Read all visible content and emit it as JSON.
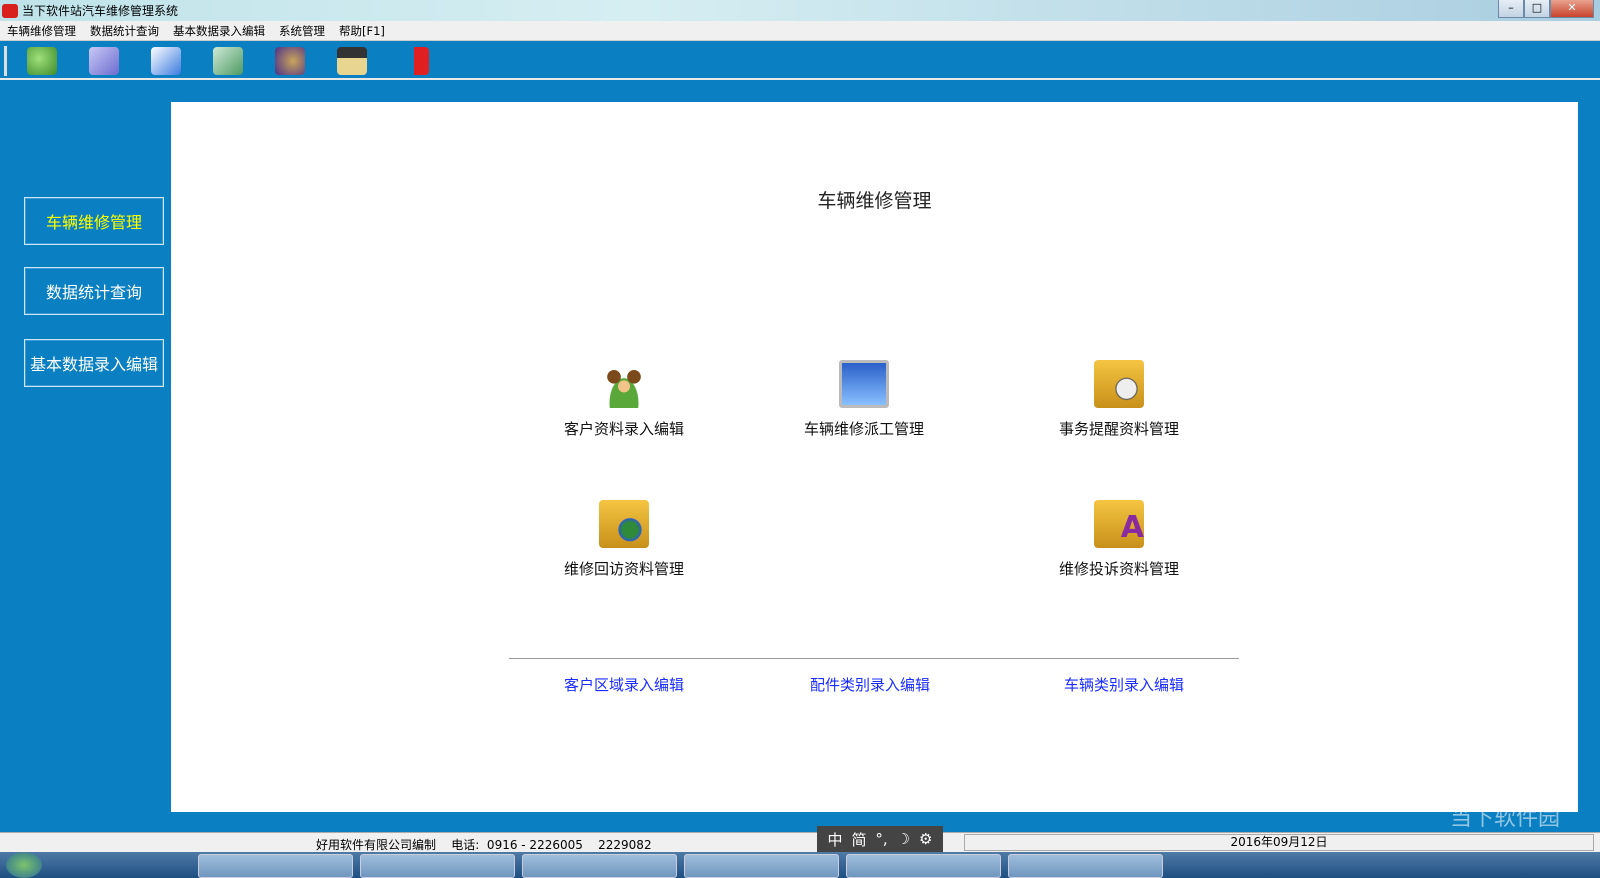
{
  "window": {
    "title": "当下软件站汽车维修管理系统",
    "minimize": "–",
    "maximize": "□",
    "close": "✕"
  },
  "menu": [
    "车辆维修管理",
    "数据统计查询",
    "基本数据录入编辑",
    "系统管理",
    "帮助[F1]"
  ],
  "toolbar": [
    {
      "icon": "users-icon",
      "color": "#6cc04a"
    },
    {
      "icon": "edit-icon",
      "color": "#8f8fe0"
    },
    {
      "icon": "ie-folder-icon",
      "color": "#3b7be0"
    },
    {
      "icon": "image-folder-icon",
      "color": "#79b88a"
    },
    {
      "icon": "music-icon",
      "color": "#5a3da0"
    },
    {
      "icon": "save-icon",
      "color": "#d8c070"
    },
    {
      "icon": "exit-icon",
      "color": "#e02020"
    }
  ],
  "sidebar": [
    "车辆维修管理",
    "数据统计查询",
    "基本数据录入编辑"
  ],
  "main": {
    "title": "车辆维修管理",
    "items": [
      "客户资料录入编辑",
      "车辆维修派工管理",
      "事务提醒资料管理",
      "维修回访资料管理",
      "维修投诉资料管理"
    ],
    "links": [
      "客户区域录入编辑",
      "配件类别录入编辑",
      "车辆类别录入编辑"
    ]
  },
  "status": {
    "company": "好用软件有限公司编制    电话:  0916 - 2226005    2229082",
    "date": "2016年09月12日"
  },
  "ime": [
    "中",
    "简",
    "°,",
    "☽",
    "⚙"
  ],
  "watermark": "当下软件园"
}
